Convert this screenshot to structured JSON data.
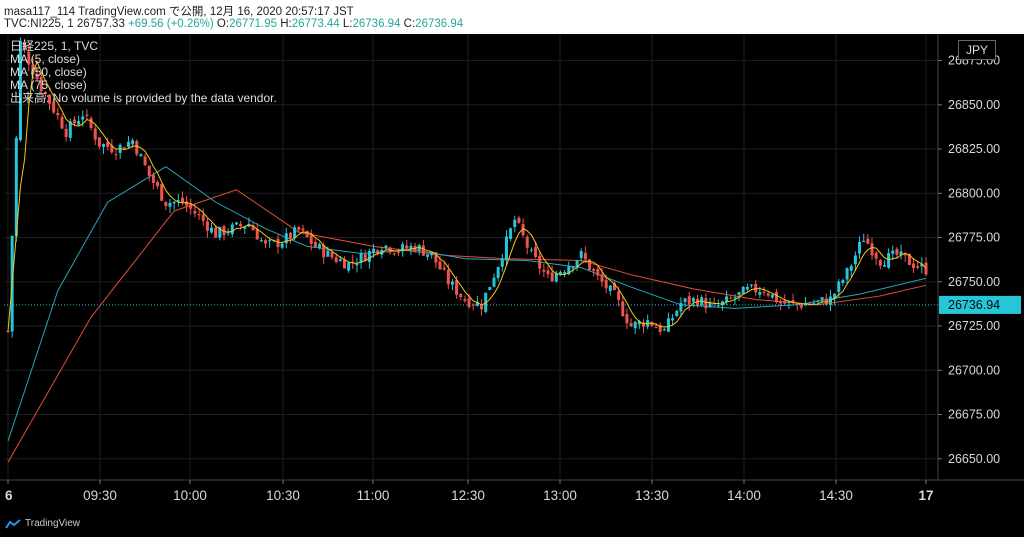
{
  "header": {
    "line1": "masa117_114 TradingView.com で公開, 12月 16, 2020 20:57:17 JST",
    "symbol": "TVC:NI225, 1",
    "last": "26757.33",
    "change": "+69.56 (+0.26%)",
    "o_label": "O:",
    "o_value": "26771.95",
    "h_label": "H:",
    "h_value": "26773.44",
    "l_label": "L:",
    "l_value": "26736.94",
    "c_label": "C:",
    "c_value": "26736.94"
  },
  "legend": {
    "symbol": "日経225, 1, TVC",
    "ma5": "MA (5, close)",
    "ma50": "MA (50, close)",
    "ma75": "MA (75, close)",
    "volume": "出来高: No volume is provided by the data vendor."
  },
  "currency": "JPY",
  "brand": "TradingView",
  "colors": {
    "up": "#26c6da",
    "down": "#ef5350",
    "ma5": "#f5c518",
    "ma50": "#26a6b5",
    "ma75": "#e84a3a",
    "price_badge": "#26c6da"
  },
  "chart_data": {
    "type": "candlestick",
    "y_ticks": [
      "26650.00",
      "26675.00",
      "26700.00",
      "26725.00",
      "26750.00",
      "26775.00",
      "26800.00",
      "26825.00",
      "26850.00",
      "26875.00"
    ],
    "x_ticks": [
      "6",
      "09:30",
      "10:00",
      "10:30",
      "11:00",
      "12:30",
      "13:00",
      "13:30",
      "14:00",
      "14:30",
      "17"
    ],
    "ylim": [
      26638,
      26890
    ],
    "last_price": "26736.94",
    "close_path": [
      {
        "t": 0,
        "v": 26722
      },
      {
        "t": 3,
        "v": 26885
      },
      {
        "t": 8,
        "v": 26860
      },
      {
        "t": 14,
        "v": 26835
      },
      {
        "t": 18,
        "v": 26845
      },
      {
        "t": 22,
        "v": 26828
      },
      {
        "t": 26,
        "v": 26825
      },
      {
        "t": 30,
        "v": 26830
      },
      {
        "t": 34,
        "v": 26810
      },
      {
        "t": 38,
        "v": 26795
      },
      {
        "t": 42,
        "v": 26795
      },
      {
        "t": 46,
        "v": 26787
      },
      {
        "t": 50,
        "v": 26777
      },
      {
        "t": 54,
        "v": 26780
      },
      {
        "t": 58,
        "v": 26783
      },
      {
        "t": 62,
        "v": 26770
      },
      {
        "t": 66,
        "v": 26773
      },
      {
        "t": 70,
        "v": 26779
      },
      {
        "t": 74,
        "v": 26770
      },
      {
        "t": 78,
        "v": 26764
      },
      {
        "t": 82,
        "v": 26760
      },
      {
        "t": 86,
        "v": 26765
      },
      {
        "t": 90,
        "v": 26771
      },
      {
        "t": 94,
        "v": 26768
      },
      {
        "t": 98,
        "v": 26770
      },
      {
        "t": 102,
        "v": 26765
      },
      {
        "t": 106,
        "v": 26750
      },
      {
        "t": 110,
        "v": 26740
      },
      {
        "t": 114,
        "v": 26737
      },
      {
        "t": 118,
        "v": 26760
      },
      {
        "t": 122,
        "v": 26785
      },
      {
        "t": 126,
        "v": 26765
      },
      {
        "t": 130,
        "v": 26752
      },
      {
        "t": 134,
        "v": 26758
      },
      {
        "t": 138,
        "v": 26765
      },
      {
        "t": 142,
        "v": 26752
      },
      {
        "t": 146,
        "v": 26742
      },
      {
        "t": 150,
        "v": 26725
      },
      {
        "t": 154,
        "v": 26728
      },
      {
        "t": 158,
        "v": 26722
      },
      {
        "t": 162,
        "v": 26738
      },
      {
        "t": 166,
        "v": 26740
      },
      {
        "t": 170,
        "v": 26735
      },
      {
        "t": 174,
        "v": 26740
      },
      {
        "t": 178,
        "v": 26745
      },
      {
        "t": 182,
        "v": 26746
      },
      {
        "t": 186,
        "v": 26738
      },
      {
        "t": 190,
        "v": 26737
      },
      {
        "t": 194,
        "v": 26738
      },
      {
        "t": 198,
        "v": 26740
      },
      {
        "t": 202,
        "v": 26755
      },
      {
        "t": 206,
        "v": 26775
      },
      {
        "t": 210,
        "v": 26762
      },
      {
        "t": 214,
        "v": 26765
      },
      {
        "t": 218,
        "v": 26760
      },
      {
        "t": 221,
        "v": 26757
      }
    ],
    "series": [
      {
        "name": "MA (5, close)",
        "t_end": 221
      },
      {
        "name": "MA (50, close)",
        "points": [
          {
            "t": 0,
            "v": 26660
          },
          {
            "t": 12,
            "v": 26745
          },
          {
            "t": 24,
            "v": 26795
          },
          {
            "t": 38,
            "v": 26815
          },
          {
            "t": 50,
            "v": 26795
          },
          {
            "t": 62,
            "v": 26780
          },
          {
            "t": 72,
            "v": 26770
          },
          {
            "t": 85,
            "v": 26766
          },
          {
            "t": 98,
            "v": 26768
          },
          {
            "t": 110,
            "v": 26763
          },
          {
            "t": 125,
            "v": 26762
          },
          {
            "t": 138,
            "v": 26758
          },
          {
            "t": 150,
            "v": 26747
          },
          {
            "t": 162,
            "v": 26737
          },
          {
            "t": 175,
            "v": 26735
          },
          {
            "t": 190,
            "v": 26737
          },
          {
            "t": 205,
            "v": 26743
          },
          {
            "t": 221,
            "v": 26752
          }
        ]
      },
      {
        "name": "MA (75, close)",
        "points": [
          {
            "t": 0,
            "v": 26648
          },
          {
            "t": 20,
            "v": 26730
          },
          {
            "t": 40,
            "v": 26790
          },
          {
            "t": 55,
            "v": 26802
          },
          {
            "t": 70,
            "v": 26778
          },
          {
            "t": 88,
            "v": 26770
          },
          {
            "t": 105,
            "v": 26765
          },
          {
            "t": 120,
            "v": 26763
          },
          {
            "t": 138,
            "v": 26762
          },
          {
            "t": 150,
            "v": 26754
          },
          {
            "t": 165,
            "v": 26746
          },
          {
            "t": 180,
            "v": 26740
          },
          {
            "t": 195,
            "v": 26737
          },
          {
            "t": 210,
            "v": 26742
          },
          {
            "t": 221,
            "v": 26748
          }
        ]
      }
    ]
  }
}
